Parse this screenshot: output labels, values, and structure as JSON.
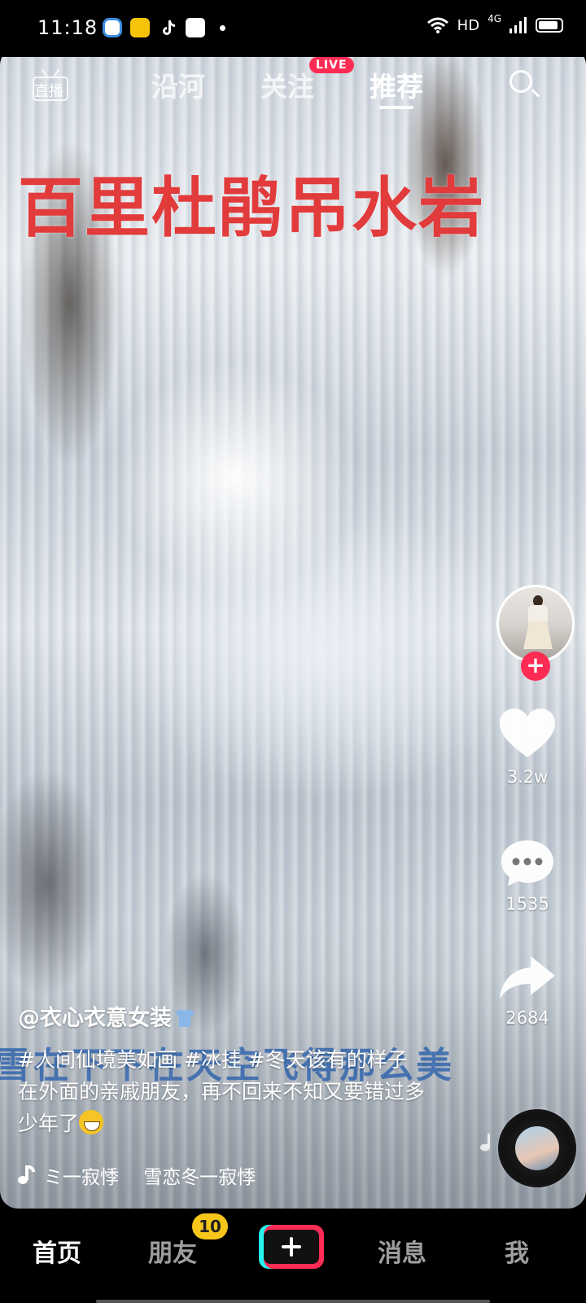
{
  "status_bar": {
    "time": "11:18",
    "network": "HD",
    "signal": "4G",
    "battery_level": 0.9,
    "app_icons": [
      "app-icon-blue",
      "app-icon-yellow",
      "tiktok-icon",
      "app-icon-video"
    ]
  },
  "top_nav": {
    "live_label": "直播",
    "tabs": [
      {
        "label": "沿河",
        "active": false
      },
      {
        "label": "关注",
        "active": false,
        "badge": "LIVE"
      },
      {
        "label": "推荐",
        "active": true
      }
    ]
  },
  "video": {
    "title_overlay": "百里杜鹃吊水岩",
    "lyric_overlay": "雪在下下在天空飞得那么美"
  },
  "right_rail": {
    "like_count": "3.2w",
    "comment_count": "1535",
    "share_count": "2684"
  },
  "caption": {
    "author": "@衣心衣意女装",
    "description": "#人间仙境美如画 #冰挂 #冬天该有的样子 在外面的亲戚朋友，再不回来不知又要错过多少年了"
  },
  "music": {
    "text": "ミ一寂悸　 雪恋冬一寂悸"
  },
  "bottom_nav": {
    "items": [
      {
        "label": "首页",
        "active": true
      },
      {
        "label": "朋友",
        "active": false,
        "badge": "10"
      },
      {
        "label": "消息",
        "active": false
      },
      {
        "label": "我",
        "active": false
      }
    ]
  },
  "colors": {
    "accent_red": "#fe2c55",
    "title_red": "#e23b3b",
    "badge_yellow": "#f6c61a",
    "cyan": "#25f4ee"
  }
}
